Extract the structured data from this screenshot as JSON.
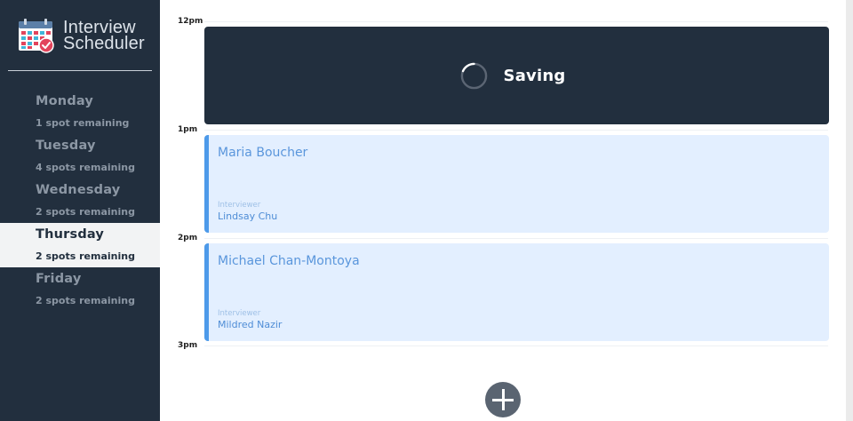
{
  "app": {
    "title_line1": "Interview",
    "title_line2": "Scheduler"
  },
  "sidebar": {
    "days": [
      {
        "name": "Monday",
        "spots": "1 spot remaining",
        "selected": false
      },
      {
        "name": "Tuesday",
        "spots": "4 spots remaining",
        "selected": false
      },
      {
        "name": "Wednesday",
        "spots": "2 spots remaining",
        "selected": false
      },
      {
        "name": "Thursday",
        "spots": "2 spots remaining",
        "selected": true
      },
      {
        "name": "Friday",
        "spots": "2 spots remaining",
        "selected": false
      }
    ]
  },
  "schedule": {
    "times": [
      "12pm",
      "1pm",
      "2pm",
      "3pm"
    ],
    "saving": {
      "text": "Saving"
    },
    "appointments": [
      {
        "student": "Maria Boucher",
        "interviewer_label": "Interviewer",
        "interviewer": "Lindsay Chu"
      },
      {
        "student": "Michael Chan-Montoya",
        "interviewer_label": "Interviewer",
        "interviewer": "Mildred Nazir"
      }
    ],
    "add_icon": "plus-icon"
  },
  "colors": {
    "sidebar_bg": "#222f3e",
    "appointment_bg": "#e3efff",
    "appointment_accent": "#4d9ae9",
    "add_button": "#5a6471"
  }
}
